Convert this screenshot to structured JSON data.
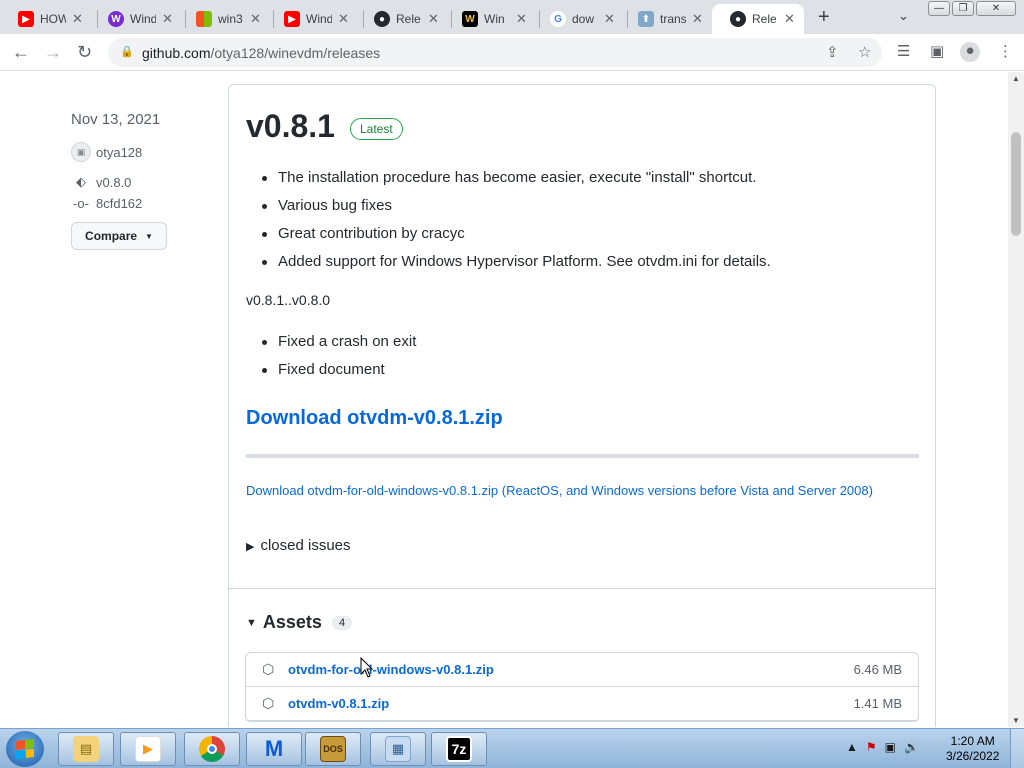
{
  "tabs": [
    {
      "title": "HOW",
      "icon": "youtube-icon",
      "color": "#ff0000"
    },
    {
      "title": "Wind",
      "icon": "wine-icon",
      "color": "#7b2bd4"
    },
    {
      "title": "win3",
      "icon": "windows-flag-icon",
      "color": "#0067c0"
    },
    {
      "title": "Wind",
      "icon": "youtube-icon",
      "color": "#ff0000"
    },
    {
      "title": "Rele",
      "icon": "github-icon",
      "color": "#24292f"
    },
    {
      "title": "Win",
      "icon": "w-logo-icon",
      "color": "#000000"
    },
    {
      "title": "dow",
      "icon": "google-icon",
      "color": "#4285f4"
    },
    {
      "title": "trans",
      "icon": "upload-icon",
      "color": "#7fa7c9"
    },
    {
      "title": "Rele",
      "icon": "github-icon",
      "color": "#24292f"
    }
  ],
  "browser": {
    "url_host": "github.com",
    "url_path": "/otya128/winevdm/releases"
  },
  "meta": {
    "date": "Nov 13, 2021",
    "author": "otya128",
    "tag": "v0.8.0",
    "commit": "8cfd162",
    "compare_label": "Compare"
  },
  "release": {
    "title": "v0.8.1",
    "badge": "Latest",
    "notes": [
      "The installation procedure has become easier, execute \"install\" shortcut.",
      "Various bug fixes",
      "Great contribution by cracyc",
      "Added support for Windows Hypervisor Platform. See otvdm.ini for details."
    ],
    "compare_text": "v0.8.1..v0.8.0",
    "fixes": [
      "Fixed a crash on exit",
      "Fixed document"
    ],
    "download_main": "Download otvdm-v0.8.1.zip",
    "download_old": "Download otvdm-for-old-windows-v0.8.1.zip (ReactOS, and Windows versions before Vista and Server 2008)",
    "closed_issues": "closed issues"
  },
  "assets": {
    "title": "Assets",
    "count": "4",
    "items": [
      {
        "name": "otvdm-for-old-windows-v0.8.1.zip",
        "size": "6.46 MB"
      },
      {
        "name": "otvdm-v0.8.1.zip",
        "size": "1.41 MB"
      }
    ]
  },
  "taskbar": {
    "time": "1:20 AM",
    "date": "3/26/2022"
  }
}
